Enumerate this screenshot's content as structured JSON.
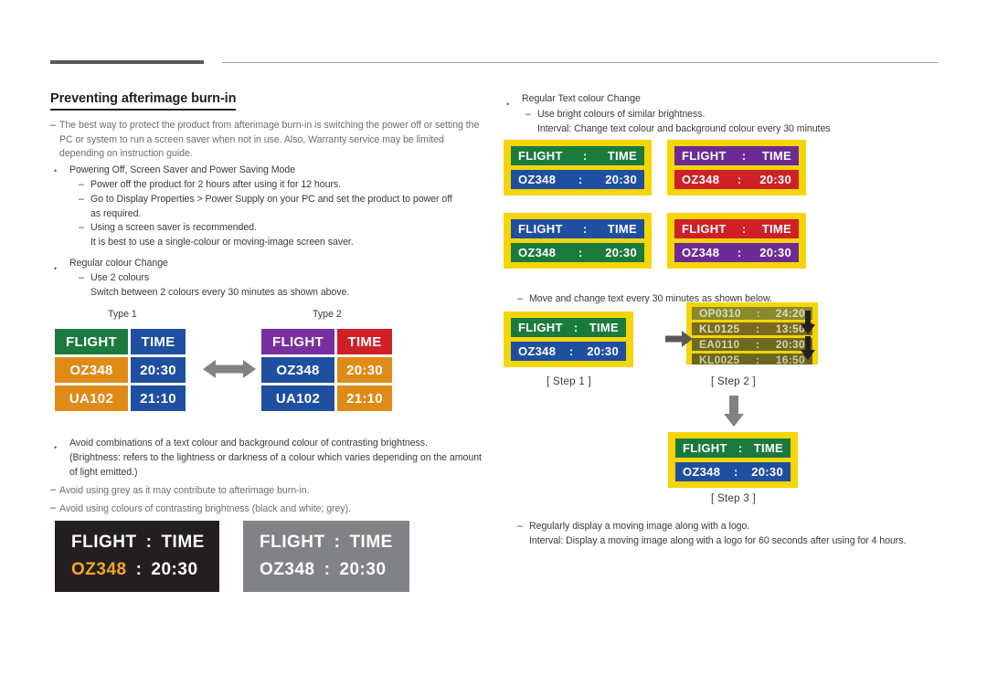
{
  "title": "Preventing afterimage burn-in",
  "left": {
    "intro": "The best way to protect the product from afterimage burn-in is switching the power off or setting the PC or system to run a screen saver when not in use. Also, Warranty service may be limited depending on instruction guide.",
    "b1": "Powering Off, Screen Saver and Power Saving Mode",
    "b1_s1": "Power off the product for 2 hours after using it for 12 hours.",
    "b1_s2": "Go to Display Properties > Power Supply on your PC and set the product to power off as required.",
    "b1_s3": "Using a screen saver is recommended.",
    "b1_s3b": "It is best to use a single-colour or moving-image screen saver.",
    "b2": "Regular colour Change",
    "b2_s1": "Use 2 colours",
    "b2_s1b": "Switch between 2 colours every 30 minutes as shown above.",
    "type1": "Type 1",
    "type2": "Type 2",
    "b3": "Avoid combinations of a text colour and background colour of contrasting brightness.",
    "b3b": "(Brightness: refers to the lightness or darkness of a colour which varies depending on the amount of light emitted.)",
    "note1": "Avoid using grey as it may contribute to afterimage burn-in.",
    "note2": "Avoid using colours of contrasting brightness (black and white; grey)."
  },
  "right": {
    "b1": "Regular Text colour Change",
    "b1_s1": "Use bright colours of similar brightness.",
    "b1_s2": "Interval: Change text colour and background colour every 30 minutes",
    "move_note": "Move and change text every 30 minutes as shown below.",
    "step1": "[ Step  1 ]",
    "step2": "[ Step  2 ]",
    "step3": "[ Step  3 ]",
    "b2_s1": "Regularly display a moving image along with a logo.",
    "b2_s2": "Interval: Display a moving image along with a logo for 60 seconds after using for 4 hours."
  },
  "boards": {
    "type1": {
      "rows": [
        {
          "left": "FLIGHT",
          "right": "TIME",
          "lbg": "#1b7a3d",
          "rbg": "#1f4fa0",
          "lfg": "#ffffff",
          "rfg": "#ffffff"
        },
        {
          "left": "OZ348",
          "right": "20:30",
          "lbg": "#e08a17",
          "rbg": "#1f4fa0",
          "lfg": "#ffffff",
          "rfg": "#ffffff"
        },
        {
          "left": "UA102",
          "right": "21:10",
          "lbg": "#e08a17",
          "rbg": "#1f4fa0",
          "lfg": "#ffffff",
          "rfg": "#ffffff"
        }
      ]
    },
    "type2": {
      "rows": [
        {
          "left": "FLIGHT",
          "right": "TIME",
          "lbg": "#7a2fa0",
          "rbg": "#cf2027",
          "lfg": "#ffffff",
          "rfg": "#ffffff"
        },
        {
          "left": "OZ348",
          "right": "20:30",
          "lbg": "#1f4fa0",
          "rbg": "#e08a17",
          "lfg": "#ffffff",
          "rfg": "#ffffff"
        },
        {
          "left": "UA102",
          "right": "21:10",
          "lbg": "#1f4fa0",
          "rbg": "#e08a17",
          "lfg": "#ffffff",
          "rfg": "#ffffff"
        }
      ]
    },
    "yellow": [
      {
        "name": "board-green-blue",
        "lines": [
          {
            "l": "FLIGHT",
            "sep": ":",
            "r": "TIME",
            "bg": "#1b7a3d",
            "fg": "#ffffff"
          },
          {
            "l": "OZ348",
            "sep": ":",
            "r": "20:30",
            "bg": "#1f4fa0",
            "fg": "#ffffff"
          }
        ]
      },
      {
        "name": "board-purple-red",
        "lines": [
          {
            "l": "FLIGHT",
            "sep": ":",
            "r": "TIME",
            "bg": "#6c2b93",
            "fg": "#ffffff"
          },
          {
            "l": "OZ348",
            "sep": ":",
            "r": "20:30",
            "bg": "#cf2027",
            "fg": "#ffffff"
          }
        ]
      },
      {
        "name": "board-blue-green",
        "lines": [
          {
            "l": "FLIGHT",
            "sep": ":",
            "r": "TIME",
            "bg": "#1f4fa0",
            "fg": "#ffffff"
          },
          {
            "l": "OZ348",
            "sep": ":",
            "r": "20:30",
            "bg": "#1b7a3d",
            "fg": "#ffffff"
          }
        ]
      },
      {
        "name": "board-red-purple",
        "lines": [
          {
            "l": "FLIGHT",
            "sep": ":",
            "r": "TIME",
            "bg": "#cf2027",
            "fg": "#ffffff"
          },
          {
            "l": "OZ348",
            "sep": ":",
            "r": "20:30",
            "bg": "#6c2b93",
            "fg": "#ffffff"
          }
        ]
      }
    ],
    "step1": {
      "lines": [
        {
          "l": "FLIGHT",
          "sep": ":",
          "r": "TIME",
          "bg": "#1b7a3d",
          "fg": "#ffffff"
        },
        {
          "l": "OZ348",
          "sep": ":",
          "r": "20:30",
          "bg": "#1f4fa0",
          "fg": "#ffffff"
        }
      ]
    },
    "step2": {
      "lines": [
        {
          "l": "OP0310",
          "sep": ":",
          "r": "24:20",
          "bg": "#8a8a2c",
          "fg": "#d9d9c0"
        },
        {
          "l": "KL0125",
          "sep": ":",
          "r": "13:50",
          "bg": "#7a6a20",
          "fg": "#e0d9b0"
        },
        {
          "l": "EA0110",
          "sep": ":",
          "r": "20:30",
          "bg": "#6d6a22",
          "fg": "#d6d2a8"
        },
        {
          "l": "KL0025",
          "sep": ":",
          "r": "16:50",
          "bg": "#6a6620",
          "fg": "#cfc9a0"
        }
      ]
    },
    "step3": {
      "lines": [
        {
          "l": "FLIGHT",
          "sep": ":",
          "r": "TIME",
          "bg": "#1b7a3d",
          "fg": "#ffffff"
        },
        {
          "l": "OZ348",
          "sep": ":",
          "r": "20:30",
          "bg": "#1f4fa0",
          "fg": "#ffffff"
        }
      ]
    },
    "dark": [
      {
        "name": "dark-board-black",
        "bg": "#231f20",
        "lines": [
          {
            "l": "FLIGHT",
            "sep": ":",
            "r": "TIME",
            "lfg": "#ffffff",
            "rfg": "#ffffff"
          },
          {
            "l": "OZ348",
            "sep": ":",
            "r": "20:30",
            "lfg": "#f5a623",
            "rfg": "#ffffff"
          }
        ]
      },
      {
        "name": "dark-board-grey",
        "bg": "#808285",
        "lines": [
          {
            "l": "FLIGHT",
            "sep": ":",
            "r": "TIME",
            "lfg": "#ffffff",
            "rfg": "#ffffff"
          },
          {
            "l": "OZ348",
            "sep": ":",
            "r": "20:30",
            "lfg": "#ffffff",
            "rfg": "#ffffff"
          }
        ]
      }
    ]
  }
}
